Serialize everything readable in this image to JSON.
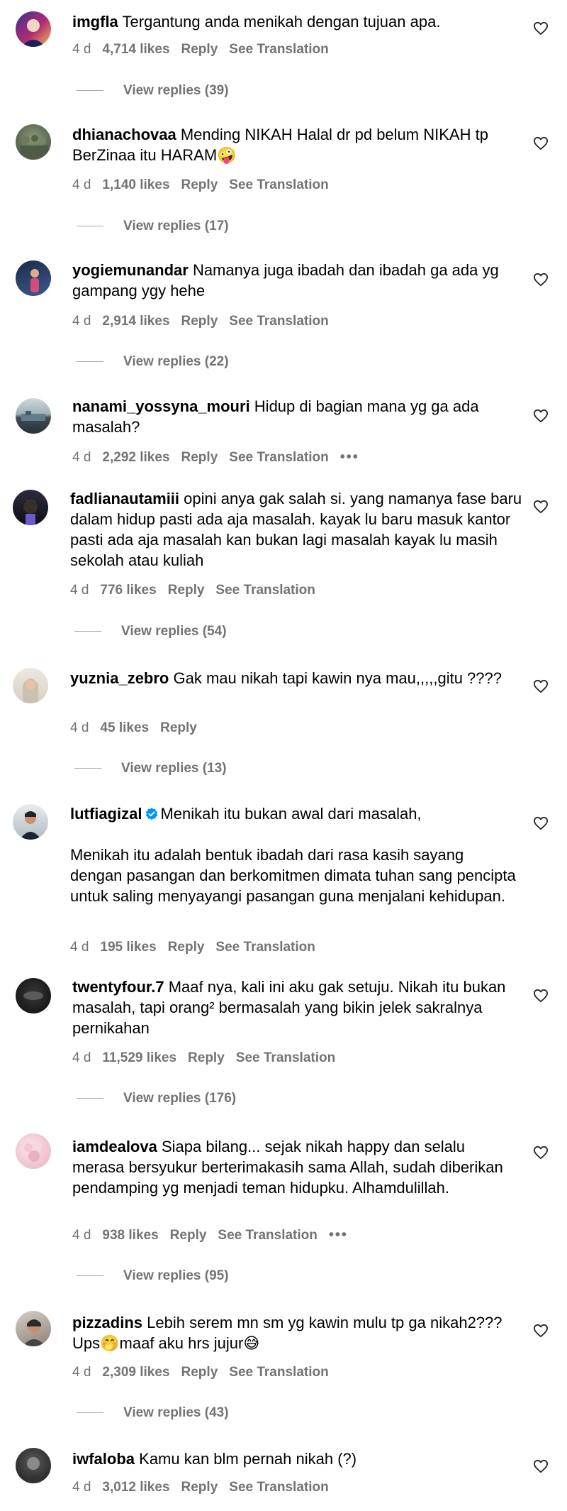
{
  "comments": [
    {
      "username": "imgfla",
      "text": "Tergantung anda menikah dengan tujuan apa.",
      "time": "4 d",
      "likes": "4,714 likes",
      "reply": "Reply",
      "translate": "See Translation",
      "replies": "View replies (39)"
    },
    {
      "username": "dhianachovaa",
      "text": "Mending NIKAH Halal dr pd belum NIKAH tp BerZinaa itu HARAM🤪",
      "time": "4 d",
      "likes": "1,140 likes",
      "reply": "Reply",
      "translate": "See Translation",
      "replies": "View replies (17)"
    },
    {
      "username": "yogiemunandar",
      "text": "Namanya juga ibadah dan ibadah ga ada yg gampang ygy hehe",
      "time": "4 d",
      "likes": "2,914 likes",
      "reply": "Reply",
      "translate": "See Translation",
      "replies": "View replies (22)"
    },
    {
      "username": "nanami_yossyna_mouri",
      "text": "Hidup di bagian mana yg ga ada masalah?",
      "time": "4 d",
      "likes": "2,292 likes",
      "reply": "Reply",
      "translate": "See Translation",
      "more": "•••"
    },
    {
      "username": "fadlianautamiii",
      "text": "opini anya gak salah si. yang namanya fase baru dalam hidup pasti ada aja masalah. kayak lu baru masuk kantor pasti ada aja masalah kan bukan lagi masalah kayak lu masih sekolah atau kuliah",
      "time": "4 d",
      "likes": "776 likes",
      "reply": "Reply",
      "translate": "See Translation",
      "replies": "View replies (54)"
    },
    {
      "username": "yuznia_zebro",
      "text": "Gak mau nikah tapi kawin nya mau,,,,,gitu ????",
      "time": "4 d",
      "likes": "45 likes",
      "reply": "Reply",
      "replies": "View replies (13)"
    },
    {
      "username": "lutfiagizal",
      "verified": true,
      "text": "Menikah itu bukan awal dari masalah,\n\nMenikah itu adalah bentuk ibadah dari rasa kasih sayang dengan pasangan dan berkomitmen dimata tuhan sang pencipta untuk saling menyayangi pasangan guna menjalani kehidupan.",
      "time": "4 d",
      "likes": "195 likes",
      "reply": "Reply",
      "translate": "See Translation"
    },
    {
      "username": "twentyfour.7",
      "text": "Maaf nya, kali ini aku gak setuju. Nikah itu bukan masalah, tapi orang² bermasalah yang bikin jelek sakralnya pernikahan",
      "time": "4 d",
      "likes": "11,529 likes",
      "reply": "Reply",
      "translate": "See Translation",
      "replies": "View replies (176)"
    },
    {
      "username": "iamdealova",
      "text": "Siapa bilang... sejak nikah happy dan selalu merasa bersyukur berterimakasih sama Allah, sudah diberikan pendamping yg menjadi teman hidupku. Alhamdulillah.",
      "time": "4 d",
      "likes": "938 likes",
      "reply": "Reply",
      "translate": "See Translation",
      "more": "•••",
      "replies": "View replies (95)"
    },
    {
      "username": "pizzadins",
      "text": "Lebih serem mn sm yg kawin mulu tp ga nikah2??? Ups🤭maaf aku hrs jujur😅",
      "time": "4 d",
      "likes": "2,309 likes",
      "reply": "Reply",
      "translate": "See Translation",
      "replies": "View replies (43)"
    },
    {
      "username": "iwfaloba",
      "text": "Kamu kan blm pernah nikah (?)",
      "time": "4 d",
      "likes": "3,012 likes",
      "reply": "Reply",
      "translate": "See Translation"
    }
  ],
  "colors": {
    "text": "#000000",
    "meta": "#737373",
    "verified": "#0095f6",
    "divider": "#a8a8a8"
  }
}
